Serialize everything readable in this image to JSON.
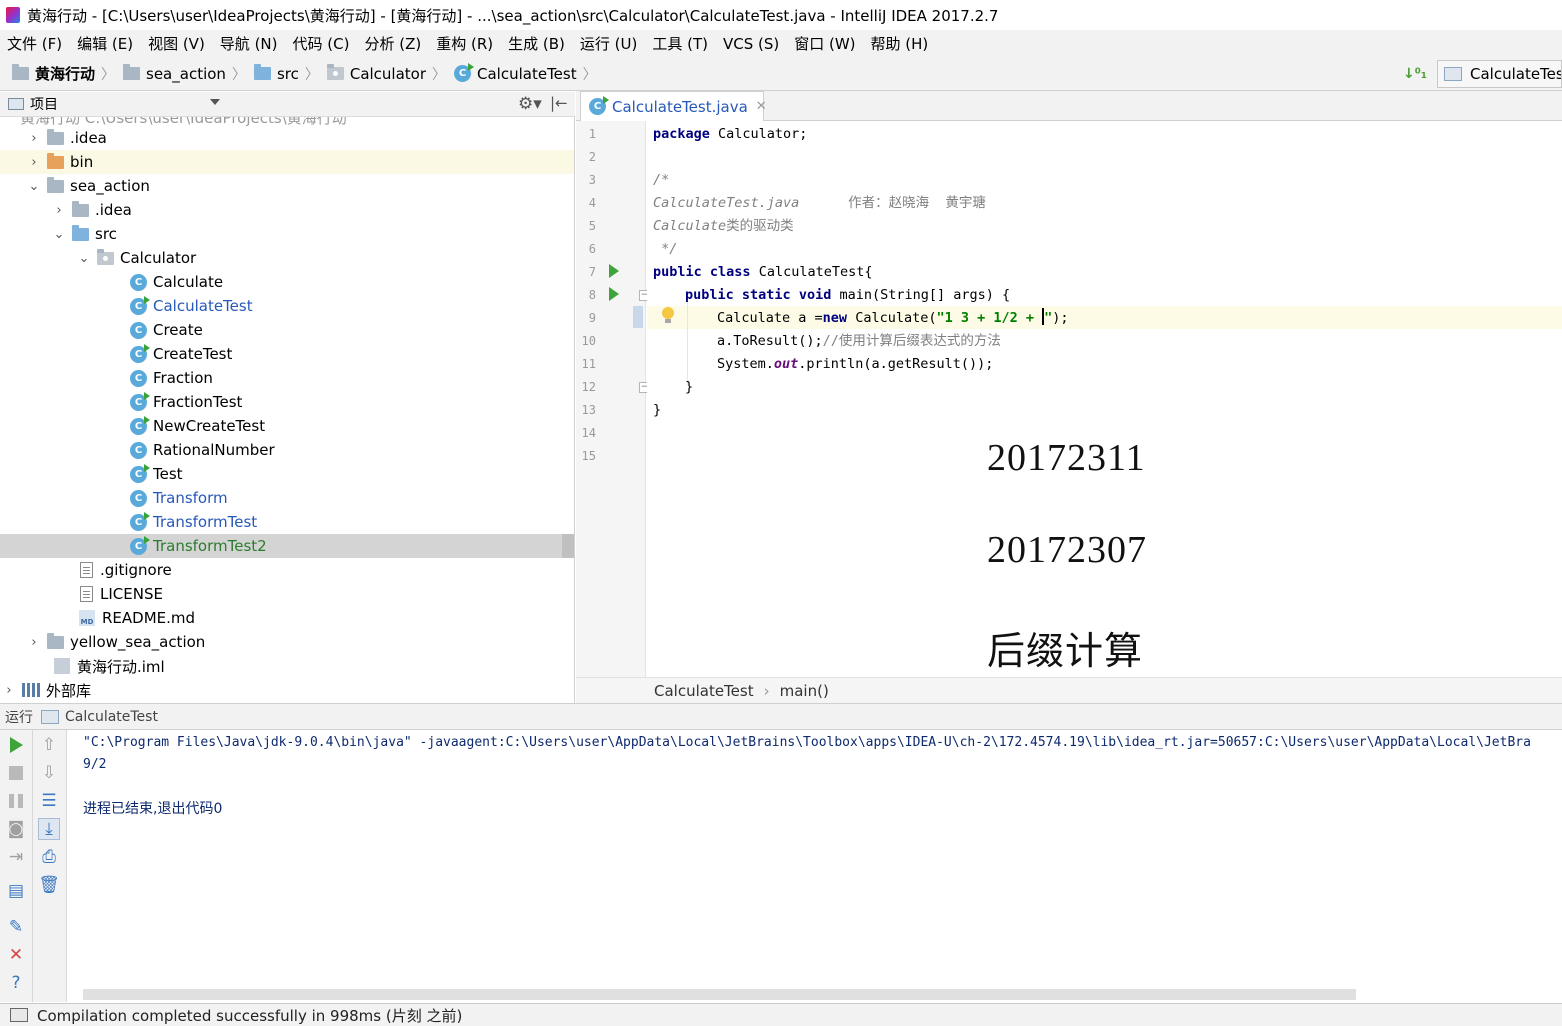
{
  "window": {
    "title": "黄海行动 - [C:\\Users\\user\\IdeaProjects\\黄海行动] - [黄海行动] - ...\\sea_action\\src\\Calculator\\CalculateTest.java - IntelliJ IDEA 2017.2.7"
  },
  "menu": [
    "文件 (F)",
    "编辑 (E)",
    "视图 (V)",
    "导航 (N)",
    "代码 (C)",
    "分析 (Z)",
    "重构 (R)",
    "生成 (B)",
    "运行 (U)",
    "工具 (T)",
    "VCS (S)",
    "窗口 (W)",
    "帮助 (H)"
  ],
  "breadcrumb": [
    "黄海行动",
    "sea_action",
    "src",
    "Calculator",
    "CalculateTest"
  ],
  "run_config": "CalculateTest",
  "project_panel": {
    "title": "项目",
    "partial_root": "黄海行动  C:\\Users\\user\\IdeaProjects\\黄海行动",
    "items": [
      {
        "label": ".idea"
      },
      {
        "label": "bin"
      },
      {
        "label": "sea_action"
      },
      {
        "label": ".idea"
      },
      {
        "label": "src"
      },
      {
        "label": "Calculator"
      },
      {
        "label": "Calculate"
      },
      {
        "label": "CalculateTest"
      },
      {
        "label": "Create"
      },
      {
        "label": "CreateTest"
      },
      {
        "label": "Fraction"
      },
      {
        "label": "FractionTest"
      },
      {
        "label": "NewCreateTest"
      },
      {
        "label": "RationalNumber"
      },
      {
        "label": "Test"
      },
      {
        "label": "Transform"
      },
      {
        "label": "TransformTest"
      },
      {
        "label": "TransformTest2"
      },
      {
        "label": ".gitignore"
      },
      {
        "label": "LICENSE"
      },
      {
        "label": "README.md"
      },
      {
        "label": "yellow_sea_action"
      },
      {
        "label": "黄海行动.iml"
      },
      {
        "label": "外部库"
      }
    ]
  },
  "editor": {
    "tab": "CalculateTest.java",
    "line_numbers": [
      "1",
      "2",
      "3",
      "4",
      "5",
      "6",
      "7",
      "8",
      "9",
      "10",
      "11",
      "12",
      "13",
      "14",
      "15"
    ],
    "code": {
      "l1_kw": "package",
      "l1_rest": " Calculator;",
      "l3": "/*",
      "l4_a": "CalculateTest.java",
      "l4_b": "      作者：赵晓海  黄宇瑭",
      "l5_a": "Calculate",
      "l5_b": "类的驱动类",
      "l6": " */",
      "l7_kw1": "public",
      "l7_kw2": "class",
      "l7_rest": " CalculateTest{",
      "l8_kw1": "public",
      "l8_kw2": "static",
      "l8_kw3": "void",
      "l8_rest": " main(String[] args) {",
      "l9_a": "Calculate a =",
      "l9_kw": "new",
      "l9_b": " Calculate(",
      "l9_str": "\"1 3 + 1/2 + ",
      "l9_str2": "\"",
      "l9_c": ");",
      "l10_a": "a.ToResult();",
      "l10_cm": "//使用计算后缀表达式的方法",
      "l11_a": "System.",
      "l11_fld": "out",
      "l11_b": ".println(a.getResult());",
      "l12": "}",
      "l13": "}"
    },
    "overlay": [
      "20172311",
      "20172307",
      "后缀计算"
    ],
    "crumbs": [
      "CalculateTest",
      "main()"
    ]
  },
  "run_panel": {
    "label": "运行",
    "config": "CalculateTest",
    "output": [
      "\"C:\\Program Files\\Java\\jdk-9.0.4\\bin\\java\" -javaagent:C:\\Users\\user\\AppData\\Local\\JetBrains\\Toolbox\\apps\\IDEA-U\\ch-2\\172.4574.19\\lib\\idea_rt.jar=50657:C:\\Users\\user\\AppData\\Local\\JetBra",
      "9/2",
      "",
      "进程已结束,退出代码0"
    ]
  },
  "status": "Compilation completed successfully in 998ms (片刻 之前)",
  "colors": {
    "keyword": "#000080",
    "string": "#008000",
    "comment": "#808080",
    "class_icon": "#59aadb",
    "run_green": "#3ea33b"
  }
}
